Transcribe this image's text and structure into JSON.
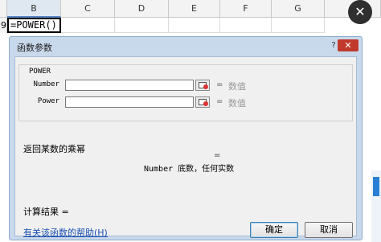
{
  "sheet": {
    "columns": [
      "B",
      "C",
      "D",
      "E",
      "F",
      "G"
    ],
    "row_number": "9",
    "active_cell_formula": "=POWER()"
  },
  "dialog": {
    "title": "函数参数",
    "help_glyph": "?",
    "close_glyph": "✕",
    "function_name": "POWER",
    "args": [
      {
        "label": "Number",
        "value": "",
        "eq": "=",
        "hint": "数值"
      },
      {
        "label": "Power",
        "value": "",
        "eq": "=",
        "hint": "数值"
      }
    ],
    "result_eq": "=",
    "description": "返回某数的乘幂",
    "arg_description_name": "Number",
    "arg_description_text": "底数，任何实数",
    "calc_result_label": "计算结果 =",
    "help_link": "有关该函数的帮助(H)",
    "ok_label": "确定",
    "cancel_label": "取消"
  },
  "overlay": {
    "close_glyph": "✕"
  }
}
